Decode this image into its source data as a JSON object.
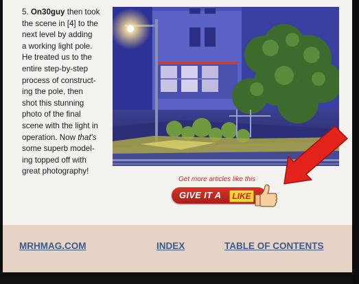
{
  "article": {
    "lines": [
      {
        "num": "5. ",
        "bold": "On30guy",
        "rest": " then took"
      },
      {
        "text": "the scene in [4] to the"
      },
      {
        "text": "next level by adding"
      },
      {
        "text": "a working light pole."
      },
      {
        "text": "He treated us to the"
      },
      {
        "text": "entire step-by-step"
      },
      {
        "text": "process of construct-"
      },
      {
        "text": "ing the pole, then"
      },
      {
        "text": "shot this stunning"
      },
      {
        "text": "photo of the final"
      },
      {
        "text": "scene with the light in"
      },
      {
        "pre": "operation. Now ",
        "italic": "that's"
      },
      {
        "text": "some superb model-"
      },
      {
        "text": "ing topped off with"
      },
      {
        "text": "great photography!"
      }
    ]
  },
  "photo": {
    "subject": "model railroad night scene with lit light pole"
  },
  "promo": {
    "tagline": "Get more articles like this",
    "give_label": "GIVE IT A",
    "like_label": "LIKE",
    "thumb_icon": "thumbs-up-icon",
    "arrow_icon": "red-arrow-icon",
    "colors": {
      "tagline": "#c0282c",
      "button": "#b8241f",
      "like_badge": "#f6d23a",
      "arrow": "#e3221b"
    }
  },
  "footer": {
    "background": "#e7d3c6",
    "link_color": "#3a5a8a",
    "site_link": "MRHMAG.COM",
    "index_link": "INDEX",
    "toc_link": "TABLE OF CONTENTS"
  }
}
